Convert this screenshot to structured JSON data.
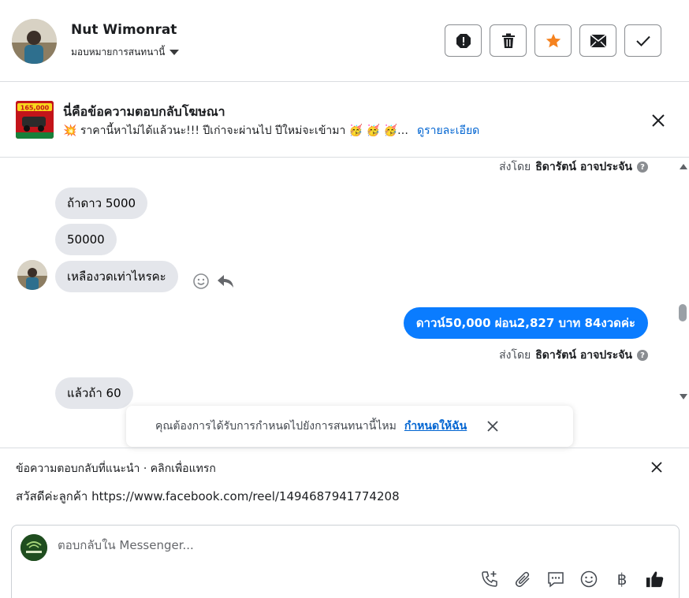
{
  "header": {
    "contact_name": "Nut Wimonrat",
    "assign_label": "มอบหมายการสนทนานี้",
    "actions": [
      "spam-icon",
      "trash-icon",
      "star-icon",
      "mark-unread-icon",
      "check-icon"
    ],
    "star_color": "#f5821f"
  },
  "ad": {
    "title": "นี่คือข้อความตอบกลับโฆษณา",
    "text": "💥 ราคานี้หาไม่ได้แล้วนะ!!! ปีเก่าจะผ่านไป ปีใหม่จะเข้ามา 🥳 🥳 🥳 โชค...",
    "details_link": "ดูรายละเอียด",
    "thumb_text": "165,000"
  },
  "thread": {
    "sent_by_prefix": "ส่งโดย",
    "sent_by_name": "ธิดารัตน์ อาจประจัน",
    "messages_in": [
      "ถ้าดาว 5000",
      "50000",
      "เหลืองวดเท่าไหรคะ"
    ],
    "message_out": "ดาวน์50,000 ผ่อน2,827 บาท 84งวดค่ะ",
    "message_in_last": "แล้วถ้า 60",
    "bubble_out_color": "#0a7cff"
  },
  "toast": {
    "text": "คุณต้องการได้รับการกำหนดไปยังการสนทนานี้ไหม",
    "link": "กำหนดให้ฉัน"
  },
  "suggest": {
    "label": "ข้อความตอบกลับที่แนะนำ · คลิกเพื่อแทรก",
    "text": "สวัสดีค่ะลูกค้า https://www.facebook.com/reel/1494687941774208"
  },
  "composer": {
    "placeholder": "ตอบกลับใน Messenger...",
    "tools": [
      "call-add-icon",
      "paperclip-icon",
      "saved-reply-icon",
      "emoji-icon",
      "baht-icon",
      "thumbs-up-icon"
    ],
    "baht_symbol": "฿"
  }
}
